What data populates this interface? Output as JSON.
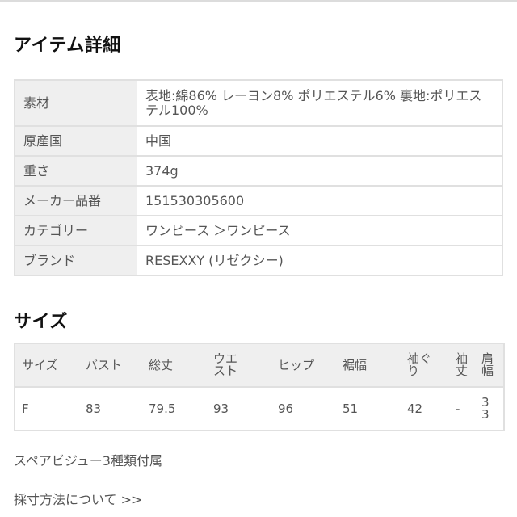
{
  "item_details": {
    "title": "アイテム詳細",
    "rows": [
      {
        "label": "素材",
        "value": "表地:綿86% レーヨン8% ポリエステル6% 裏地:ポリエステル100%"
      },
      {
        "label": "原産国",
        "value": "中国"
      },
      {
        "label": "重さ",
        "value": "374g"
      },
      {
        "label": "メーカー品番",
        "value": "151530305600"
      },
      {
        "label": "カテゴリー",
        "value": "ワンピース ＞ワンピース"
      },
      {
        "label": "ブランド",
        "value": "RESEXXY (リゼクシー)"
      }
    ]
  },
  "size": {
    "title": "サイズ",
    "headers": [
      "サイズ",
      "バスト",
      "総丈",
      "ウエスト",
      "ヒップ",
      "裾幅",
      "袖ぐり",
      "袖丈",
      "肩幅"
    ],
    "rows": [
      [
        "F",
        "83",
        "79.5",
        "93",
        "96",
        "51",
        "42",
        "-",
        "33"
      ]
    ]
  },
  "notes": {
    "spare": "スペアビジュー3種類付属",
    "measure_link": "採寸方法について >>"
  }
}
